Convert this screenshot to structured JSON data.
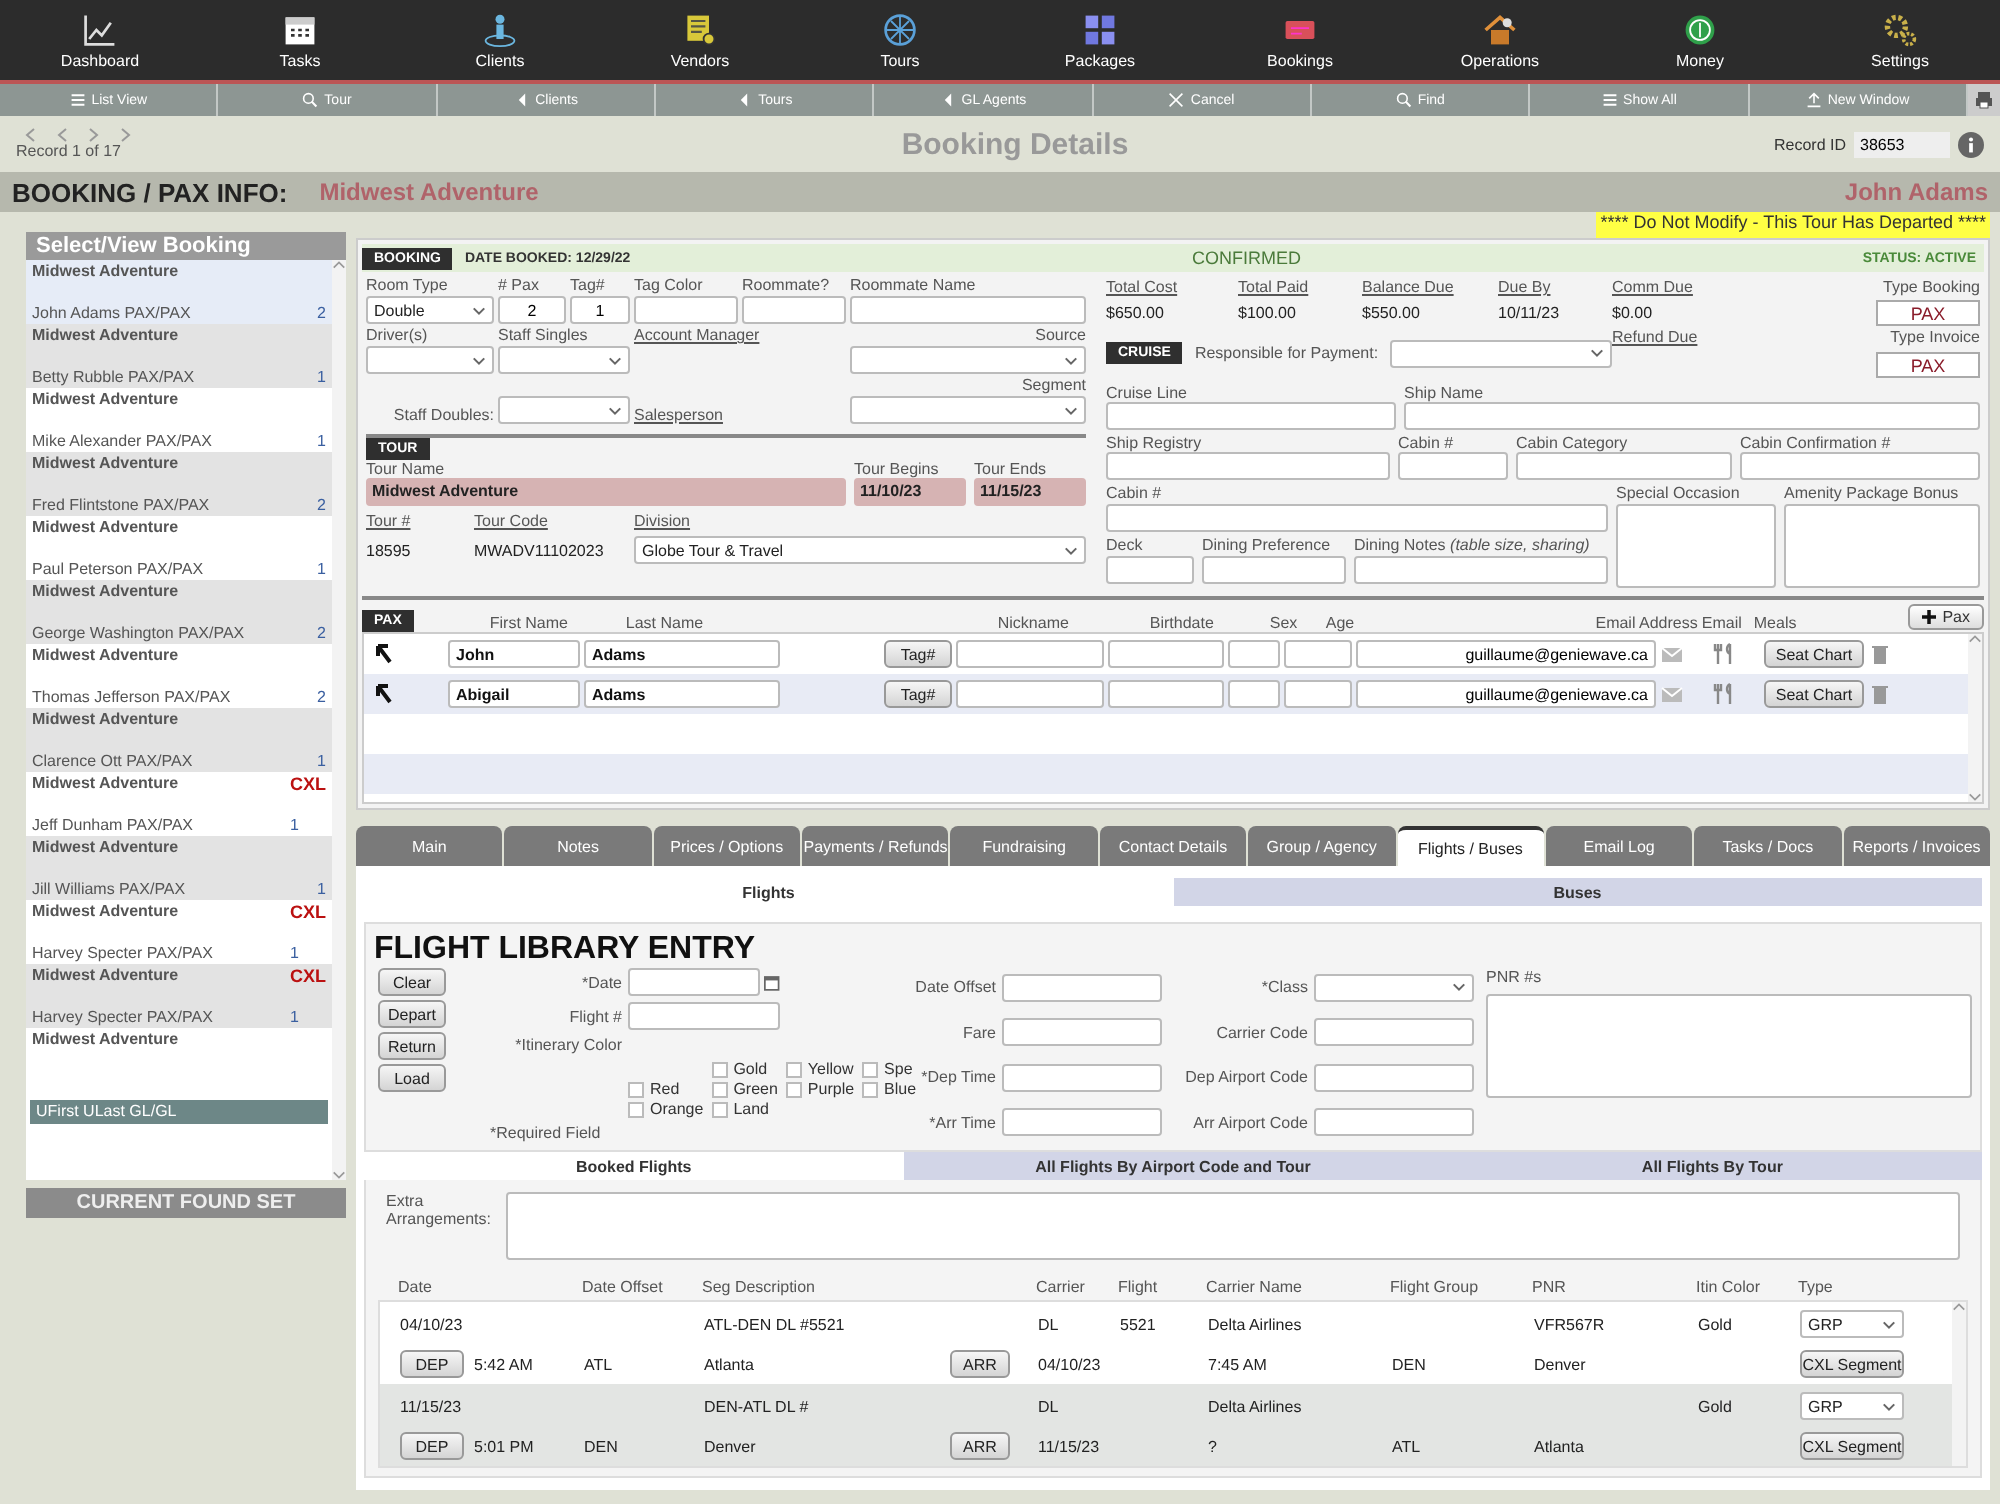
{
  "nav": [
    {
      "label": "Dashboard"
    },
    {
      "label": "Tasks"
    },
    {
      "label": "Clients"
    },
    {
      "label": "Vendors"
    },
    {
      "label": "Tours"
    },
    {
      "label": "Packages"
    },
    {
      "label": "Bookings"
    },
    {
      "label": "Operations"
    },
    {
      "label": "Money"
    },
    {
      "label": "Settings"
    }
  ],
  "toolbar": [
    {
      "label": "List View"
    },
    {
      "label": "Tour"
    },
    {
      "label": "Clients"
    },
    {
      "label": "Tours"
    },
    {
      "label": "GL Agents"
    },
    {
      "label": "Cancel"
    },
    {
      "label": "Find"
    },
    {
      "label": "Show All"
    },
    {
      "label": "New Window"
    }
  ],
  "header": {
    "record_count": "Record 1 of 17",
    "title": "Booking Details",
    "record_id_label": "Record ID",
    "record_id": "38653"
  },
  "banner": {
    "label": "BOOKING / PAX INFO:",
    "tour": "Midwest Adventure",
    "client": "John Adams"
  },
  "warning": "**** Do Not Modify - This Tour Has Departed ****",
  "sidebar": {
    "title": "Select/View Booking",
    "items": [
      {
        "tour": "Midwest Adventure",
        "pax": "John Adams  PAX/PAX",
        "count": "2",
        "selected": true
      },
      {
        "tour": "Midwest Adventure",
        "pax": "Betty Rubble  PAX/PAX",
        "count": "1",
        "selected": false
      },
      {
        "tour": "Midwest Adventure",
        "pax": "Mike Alexander  PAX/PAX",
        "count": "1",
        "selected": false
      },
      {
        "tour": "Midwest Adventure",
        "pax": "Fred Flintstone  PAX/PAX",
        "count": "2",
        "selected": false
      },
      {
        "tour": "Midwest Adventure",
        "pax": "Paul Peterson  PAX/PAX",
        "count": "1",
        "selected": false
      },
      {
        "tour": "Midwest Adventure",
        "pax": "George Washington  PAX/PAX",
        "count": "2",
        "selected": false
      },
      {
        "tour": "Midwest Adventure",
        "pax": "Thomas Jefferson  PAX/PAX",
        "count": "2",
        "selected": false
      },
      {
        "tour": "Midwest Adventure",
        "pax": "Clarence Ott  PAX/PAX",
        "count": "1",
        "selected": false
      },
      {
        "tour": "Midwest Adventure",
        "status": "CXL",
        "pax": "Jeff Dunham  PAX/PAX",
        "count": "1",
        "selected": false
      },
      {
        "tour": "Midwest Adventure",
        "pax": "Jill Williams  PAX/PAX",
        "count": "1",
        "selected": false
      },
      {
        "tour": "Midwest Adventure",
        "status": "CXL",
        "pax": "Harvey Specter  PAX/PAX",
        "count": "1",
        "selected": false
      },
      {
        "tour": "Midwest Adventure",
        "status": "CXL",
        "pax": "Harvey Specter  PAX/PAX",
        "count": "1",
        "selected": false
      },
      {
        "tour": "Midwest Adventure",
        "selected": false
      }
    ],
    "search_value": "UFirst ULast  GL/GL",
    "footer_button": "CURRENT FOUND SET"
  },
  "booking": {
    "label": "BOOKING",
    "date_booked": "DATE BOOKED: 12/29/22",
    "status": "CONFIRMED",
    "active": "STATUS: ACTIVE",
    "room_type": {
      "label": "Room Type",
      "value": "Double"
    },
    "pax_count": {
      "label": "# Pax",
      "value": "2"
    },
    "tag": {
      "label": "Tag#",
      "value": "1"
    },
    "tag_color": {
      "label": "Tag Color"
    },
    "roommate": {
      "label": "Roommate?"
    },
    "roommate_name": {
      "label": "Roommate Name"
    },
    "drivers": {
      "label": "Driver(s)"
    },
    "staff_singles": {
      "label": "Staff Singles"
    },
    "account_manager": "Account Manager",
    "source": {
      "label": "Source"
    },
    "staff_doubles": {
      "label": "Staff Doubles:"
    },
    "salesperson": "Salesperson",
    "segment": {
      "label": "Segment"
    },
    "financials": [
      {
        "label": "Total Cost",
        "value": "$650.00"
      },
      {
        "label": "Total  Paid",
        "value": "$100.00"
      },
      {
        "label": "Balance Due",
        "value": "$550.00"
      },
      {
        "label": "Due By",
        "value": "10/11/23"
      },
      {
        "label": "Comm Due",
        "value": "$0.00"
      }
    ],
    "refund_due": "Refund Due",
    "type_booking": {
      "label": "Type Booking",
      "value": "PAX"
    },
    "type_invoice": {
      "label": "Type Invoice",
      "value": "PAX"
    }
  },
  "cruise": {
    "label": "CRUISE",
    "responsible": "Responsible for Payment:",
    "cruise_line": "Cruise Line",
    "ship_name": "Ship Name",
    "ship_registry": "Ship Registry",
    "cabin_no": "Cabin #",
    "cabin_category": "Cabin Category",
    "cabin_confirmation": "Cabin Confirmation #",
    "cabin": "Cabin #",
    "special_occasion": "Special Occasion",
    "amenity": "Amenity Package Bonus",
    "deck": "Deck",
    "dining_preference": "Dining Preference",
    "dining_notes": "Dining Notes *(table size, sharing)*"
  },
  "tour": {
    "label": "TOUR",
    "name_label": "Tour Name",
    "name": "Midwest Adventure",
    "begins_label": "Tour Begins",
    "begins": "11/10/23",
    "ends_label": "Tour Ends",
    "ends": "11/15/23",
    "number_label": "Tour #",
    "number": "18595",
    "code_label": "Tour Code",
    "code": "MWADV11102023",
    "division_label": "Division",
    "division": "Globe Tour & Travel"
  },
  "pax": {
    "label": "PAX",
    "columns": [
      "First Name",
      "Last Name",
      "Nickname",
      "Birthdate",
      "Sex",
      "Age",
      "Email Address",
      "Email",
      "Meals"
    ],
    "add_label": "Pax",
    "rows": [
      {
        "first": "John",
        "last": "Adams",
        "tag_label": "Tag#",
        "email": "guillaume@geniewave.ca",
        "seat_label": "Seat Chart"
      },
      {
        "first": "Abigail",
        "last": "Adams",
        "tag_label": "Tag#",
        "email": "guillaume@geniewave.ca",
        "seat_label": "Seat Chart"
      }
    ]
  },
  "tabs": [
    {
      "label": "Main",
      "selected": false
    },
    {
      "label": "Notes",
      "selected": false
    },
    {
      "label": "Prices / Options",
      "selected": false
    },
    {
      "label": "Payments / Refunds",
      "selected": false
    },
    {
      "label": "Fundraising",
      "selected": false
    },
    {
      "label": "Contact Details",
      "selected": false
    },
    {
      "label": "Group / Agency",
      "selected": false
    },
    {
      "label": "Flights / Buses",
      "selected": true
    },
    {
      "label": "Email Log",
      "selected": false
    },
    {
      "label": "Tasks / Docs",
      "selected": false
    },
    {
      "label": "Reports / Invoices",
      "selected": false
    }
  ],
  "subtabs": [
    {
      "label": "Flights",
      "selected": true
    },
    {
      "label": "Buses",
      "selected": false
    }
  ],
  "flight_entry": {
    "title": "FLIGHT LIBRARY ENTRY",
    "buttons": [
      "Clear",
      "Depart",
      "Return",
      "Load"
    ],
    "date": "*Date",
    "flight_no": "Flight #",
    "itinerary_color": "*Itinerary Color",
    "colors": [
      {
        "label": "Gold",
        "checked": false
      },
      {
        "label": "Yellow",
        "checked": false
      },
      {
        "label": "Spe",
        "checked": false
      },
      {
        "label": "Red",
        "checked": false
      },
      {
        "label": "Green",
        "checked": false
      },
      {
        "label": "Purple",
        "checked": false
      },
      {
        "label": "Blue",
        "checked": false
      },
      {
        "label": "Orange",
        "checked": false
      },
      {
        "label": "Land",
        "checked": false
      }
    ],
    "required_note": "*Required Field",
    "date_offset": "Date Offset",
    "fare": "Fare",
    "dep_time": "*Dep Time",
    "arr_time": "*Arr Time",
    "class": "*Class",
    "carrier_code": "Carrier Code",
    "dep_airport": "Dep Airport Code",
    "arr_airport": "Arr Airport Code",
    "pnr": "PNR #s"
  },
  "flight_tabs": [
    {
      "label": "Booked Flights",
      "selected": true
    },
    {
      "label": "All Flights By Airport Code and Tour",
      "selected": false
    },
    {
      "label": "All Flights By Tour",
      "selected": false
    }
  ],
  "extra_arrangements": "Extra Arrangements:",
  "flights": {
    "columns": [
      "Date",
      "Date Offset",
      "Seg Description",
      "",
      "Carrier",
      "Flight",
      "Carrier Name",
      "Flight Group",
      "PNR",
      "Itin Color",
      "Type"
    ],
    "rows": [
      {
        "date": "04/10/23",
        "seg": "ATL-DEN DL #5521",
        "carrier": "DL",
        "flight": "5521",
        "carrier_name": "Delta Airlines",
        "pnr": "VFR567R",
        "itin_color": "Gold",
        "type": "GRP",
        "dep_label": "DEP",
        "dep_time": "5:42 AM",
        "dep_airport": "ATL",
        "dep_city": "Atlanta",
        "arr_label": "ARR",
        "arr_date": "04/10/23",
        "arr_time": "7:45 AM",
        "arr_airport": "DEN",
        "arr_city": "Denver",
        "cxl_label": "CXL Segment"
      },
      {
        "date": "11/15/23",
        "seg": "DEN-ATL DL #",
        "carrier": "DL",
        "carrier_name": "Delta Airlines",
        "itin_color": "Gold",
        "type": "GRP",
        "dep_label": "DEP",
        "dep_time": "5:01 PM",
        "dep_airport": "DEN",
        "dep_city": "Denver",
        "arr_label": "ARR",
        "arr_date": "11/15/23",
        "arr_time": "?",
        "arr_airport": "ATL",
        "arr_city": "Atlanta",
        "cxl_label": "CXL Segment"
      }
    ]
  }
}
